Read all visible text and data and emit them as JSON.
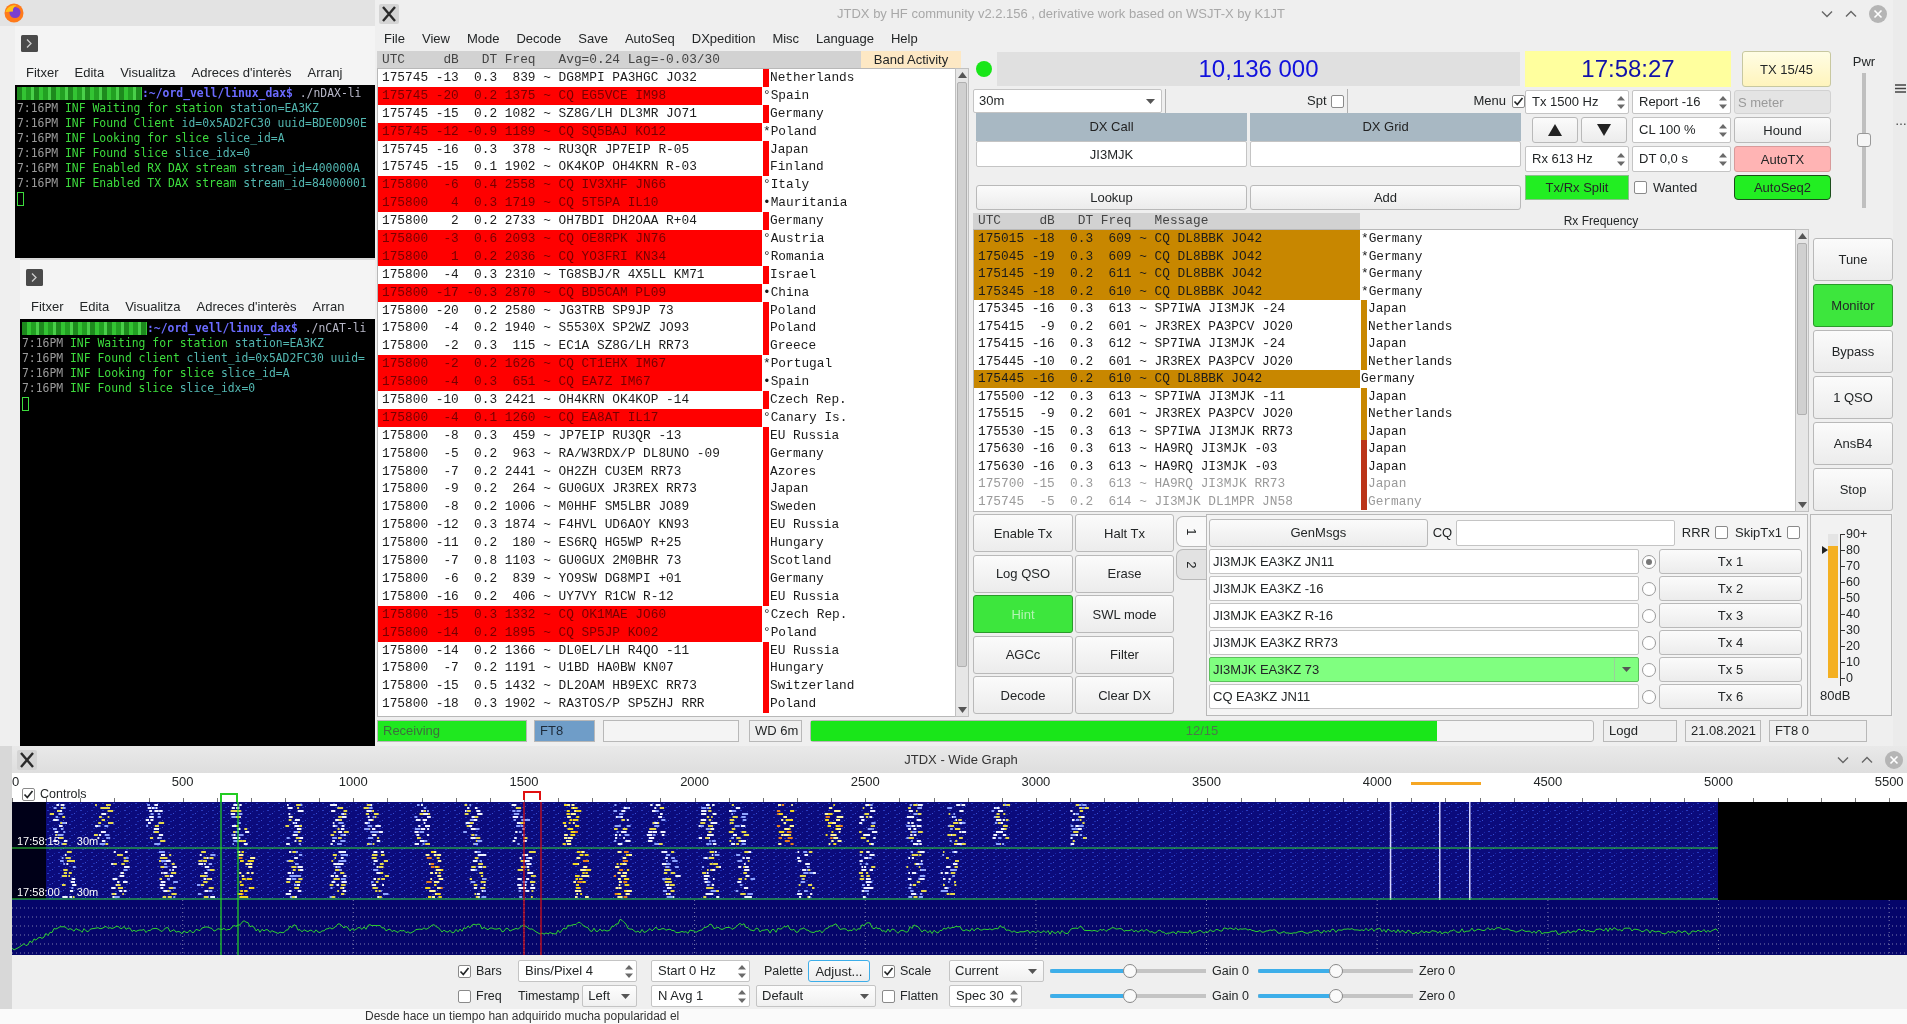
{
  "desktop": {
    "terminals": [
      {
        "menu": [
          "Fitxer",
          "Edita",
          "Visualitza",
          "Adreces d'interès",
          "Arranj"
        ],
        "prompt": {
          "path": ":~/ord_vell/linux_dax$",
          "command": "./nDAX-li"
        },
        "lines": [
          {
            "time": "7:16PM",
            "level": "INF",
            "message": "Waiting for station",
            "fields": "station=EA3KZ"
          },
          {
            "time": "7:16PM",
            "level": "INF",
            "message": "Found Client",
            "fields": "id=0x5AD2FC30 uuid=BDE0D90E"
          },
          {
            "time": "7:16PM",
            "level": "INF",
            "message": "Looking for slice",
            "fields": "slice_id=A"
          },
          {
            "time": "7:16PM",
            "level": "INF",
            "message": "Found slice",
            "fields": "slice_idx=0"
          },
          {
            "time": "7:16PM",
            "level": "INF",
            "message": "Enabled RX DAX stream",
            "fields": "stream_id=400000A"
          },
          {
            "time": "7:16PM",
            "level": "INF",
            "message": "Enabled TX DAX stream",
            "fields": "stream_id=84000001"
          }
        ]
      },
      {
        "menu": [
          "Fitxer",
          "Edita",
          "Visualitza",
          "Adreces d'interès",
          "Arran"
        ],
        "prompt": {
          "path": ":~/ord_vell/linux_dax$",
          "command": "./nCAT-li"
        },
        "lines": [
          {
            "time": "7:16PM",
            "level": "INF",
            "message": "Waiting for station",
            "fields": "station=EA3KZ"
          },
          {
            "time": "7:16PM",
            "level": "INF",
            "message": "Found client",
            "fields": "client_id=0x5AD2FC30 uuid="
          },
          {
            "time": "7:16PM",
            "level": "INF",
            "message": "Looking for slice",
            "fields": "slice_id=A"
          },
          {
            "time": "7:16PM",
            "level": "INF",
            "message": "Found slice",
            "fields": "slice_idx=0"
          }
        ]
      }
    ],
    "edge_text": "…",
    "page_text": "Desde hace un tiempo han adquirido mucha popularidad el"
  },
  "main_window": {
    "title": "JTDX by HF community v2.2.156 , derivative work based on WSJT-X by K1JT",
    "menu": [
      "File",
      "View",
      "Mode",
      "Decode",
      "Save",
      "AutoSeq",
      "DXpedition",
      "Misc",
      "Language",
      "Help"
    ]
  },
  "band_activity": {
    "title": "Band Activity",
    "columns": [
      "UTC",
      "dB",
      "DT",
      "Freq",
      "Avg=0.24 Lag=-0.03/30"
    ],
    "rows": [
      {
        "utc": "175745",
        "db": "-13",
        "dt": "0.3",
        "freq": "839",
        "message": "~ DG8MPI PA3HGC JO32",
        "country": "Netherlands",
        "highlighted": false
      },
      {
        "utc": "175745",
        "db": "-20",
        "dt": "0.2",
        "freq": "1375",
        "message": "~ CQ EG5VCE IM98",
        "country": "°Spain",
        "highlighted": true
      },
      {
        "utc": "175745",
        "db": "-15",
        "dt": "0.2",
        "freq": "1082",
        "message": "~ SZ8G/LH DL3MR JO71",
        "country": "Germany",
        "highlighted": false
      },
      {
        "utc": "175745",
        "db": "-12",
        "dt": "-0.9",
        "freq": "1189",
        "message": "~ CQ SQ5BAJ KO12",
        "country": "*Poland",
        "highlighted": true
      },
      {
        "utc": "175745",
        "db": "-16",
        "dt": "0.3",
        "freq": "378",
        "message": "~ RU3QR JP7EIP R-05",
        "country": "Japan",
        "highlighted": false
      },
      {
        "utc": "175745",
        "db": "-15",
        "dt": "0.1",
        "freq": "1902",
        "message": "~ OK4KOP OH4KRN R-03",
        "country": "Finland",
        "highlighted": false
      },
      {
        "utc": "175800",
        "db": "-6",
        "dt": "0.4",
        "freq": "2558",
        "message": "~ CQ IV3XHF JN66",
        "country": "°Italy",
        "highlighted": true
      },
      {
        "utc": "175800",
        "db": "4",
        "dt": "0.3",
        "freq": "1719",
        "message": "~ CQ 5T5PA IL10",
        "country": "•Mauritania",
        "highlighted": true
      },
      {
        "utc": "175800",
        "db": "2",
        "dt": "0.2",
        "freq": "2733",
        "message": "~ OH7BDI DH2OAA R+04",
        "country": "Germany",
        "highlighted": false
      },
      {
        "utc": "175800",
        "db": "-3",
        "dt": "0.6",
        "freq": "2093",
        "message": "~ CQ OE8RPK JN76",
        "country": "°Austria",
        "highlighted": true
      },
      {
        "utc": "175800",
        "db": "1",
        "dt": "0.2",
        "freq": "2036",
        "message": "~ CQ YO3FRI KN34",
        "country": "°Romania",
        "highlighted": true
      },
      {
        "utc": "175800",
        "db": "-4",
        "dt": "0.3",
        "freq": "2310",
        "message": "~ TG8SBJ/R 4X5LL KM71",
        "country": "Israel",
        "highlighted": false
      },
      {
        "utc": "175800",
        "db": "-17",
        "dt": "-0.3",
        "freq": "2870",
        "message": "~ CQ BD5CAM PL09",
        "country": "•China",
        "highlighted": true
      },
      {
        "utc": "175800",
        "db": "-20",
        "dt": "0.2",
        "freq": "2580",
        "message": "~ JG3TRB SP9JP 73",
        "country": "Poland",
        "highlighted": false
      },
      {
        "utc": "175800",
        "db": "-4",
        "dt": "0.2",
        "freq": "1940",
        "message": "~ S5530X SP2WZ JO93",
        "country": "Poland",
        "highlighted": false
      },
      {
        "utc": "175800",
        "db": "-2",
        "dt": "0.3",
        "freq": "115",
        "message": "~ EC1A SZ8G/LH RR73",
        "country": "Greece",
        "highlighted": false
      },
      {
        "utc": "175800",
        "db": "-2",
        "dt": "0.2",
        "freq": "1626",
        "message": "~ CQ CT1EHX IM67",
        "country": "*Portugal",
        "highlighted": true
      },
      {
        "utc": "175800",
        "db": "-4",
        "dt": "0.3",
        "freq": "651",
        "message": "~ CQ EA7Z IM67",
        "country": "•Spain",
        "highlighted": true
      },
      {
        "utc": "175800",
        "db": "-10",
        "dt": "0.3",
        "freq": "2421",
        "message": "~ OH4KRN OK4KOP -14",
        "country": "Czech Rep.",
        "highlighted": false
      },
      {
        "utc": "175800",
        "db": "-4",
        "dt": "0.1",
        "freq": "1260",
        "message": "~ CQ EA8AT IL17",
        "country": "°Canary Is.",
        "highlighted": true
      },
      {
        "utc": "175800",
        "db": "-8",
        "dt": "0.3",
        "freq": "459",
        "message": "~ JP7EIP RU3QR -13",
        "country": "EU Russia",
        "highlighted": false
      },
      {
        "utc": "175800",
        "db": "-5",
        "dt": "0.2",
        "freq": "963",
        "message": "~ RA/W3RDX/P DL8UNO -09",
        "country": "Germany",
        "highlighted": false
      },
      {
        "utc": "175800",
        "db": "-7",
        "dt": "0.2",
        "freq": "2441",
        "message": "~ OH2ZH CU3EM RR73",
        "country": "Azores",
        "highlighted": false
      },
      {
        "utc": "175800",
        "db": "-9",
        "dt": "0.2",
        "freq": "264",
        "message": "~ GU0GUX JR3REX RR73",
        "country": "Japan",
        "highlighted": false
      },
      {
        "utc": "175800",
        "db": "-8",
        "dt": "0.2",
        "freq": "1006",
        "message": "~ M0HHF SM5LBR JO89",
        "country": "Sweden",
        "highlighted": false
      },
      {
        "utc": "175800",
        "db": "-12",
        "dt": "0.3",
        "freq": "1874",
        "message": "~ F4HVL UD6AOY KN93",
        "country": "EU Russia",
        "highlighted": false
      },
      {
        "utc": "175800",
        "db": "-11",
        "dt": "0.2",
        "freq": "180",
        "message": "~ ES6RQ HG5WP R+25",
        "country": "Hungary",
        "highlighted": false
      },
      {
        "utc": "175800",
        "db": "-7",
        "dt": "0.8",
        "freq": "1103",
        "message": "~ GU0GUX 2M0BHR 73",
        "country": "Scotland",
        "highlighted": false
      },
      {
        "utc": "175800",
        "db": "-6",
        "dt": "0.2",
        "freq": "839",
        "message": "~ YO9SW DG8MPI +01",
        "country": "Germany",
        "highlighted": false
      },
      {
        "utc": "175800",
        "db": "-16",
        "dt": "0.2",
        "freq": "406",
        "message": "~ UY7VY R1CW R-12",
        "country": "EU Russia",
        "highlighted": false
      },
      {
        "utc": "175800",
        "db": "-15",
        "dt": "0.3",
        "freq": "1332",
        "message": "~ CQ OK1MAE JO60",
        "country": "°Czech Rep.",
        "highlighted": true
      },
      {
        "utc": "175800",
        "db": "-14",
        "dt": "0.2",
        "freq": "1895",
        "message": "~ CQ SP5JP KO02",
        "country": "°Poland",
        "highlighted": true
      },
      {
        "utc": "175800",
        "db": "-14",
        "dt": "0.2",
        "freq": "1366",
        "message": "~ DL0EL/LH R4QO -11",
        "country": "EU Russia",
        "highlighted": false
      },
      {
        "utc": "175800",
        "db": "-7",
        "dt": "0.2",
        "freq": "1191",
        "message": "~ U1BD HA0BW KN07",
        "country": "Hungary",
        "highlighted": false
      },
      {
        "utc": "175800",
        "db": "-15",
        "dt": "0.5",
        "freq": "1432",
        "message": "~ DL2OAM HB9EXC RR73",
        "country": "Switzerland",
        "highlighted": false
      },
      {
        "utc": "175800",
        "db": "-18",
        "dt": "0.3",
        "freq": "1902",
        "message": "~ RA3TOS/P SP5ZHJ RRR",
        "country": "Poland",
        "highlighted": false
      }
    ]
  },
  "top": {
    "decoder_on": true,
    "frequency": "10,136 000",
    "clock": "17:58:27",
    "tx_period": "TX 15/45",
    "band": "30m",
    "spt": {
      "label": "Spt",
      "checked": false
    },
    "menu_toggle": {
      "label": "Menu",
      "checked": true
    },
    "dx_call": {
      "label": "DX Call",
      "value": "JI3MJK"
    },
    "dx_grid": {
      "label": "DX Grid"
    },
    "lookup": "Lookup",
    "add": "Add",
    "tx_freq": "Tx 1500 Hz",
    "report": "Report -16",
    "s_meter": {
      "label": "S meter",
      "disabled": true
    },
    "cl": "CL 100 %",
    "hound": "Hound",
    "rx_freq": "Rx 613 Hz",
    "dt": "DT 0,0 s",
    "auto_tx": {
      "label": "AutoTX",
      "on": false
    },
    "split": {
      "label": "Tx/Rx Split",
      "on": true
    },
    "wanted": {
      "label": "Wanted",
      "checked": false
    },
    "autoseq": {
      "label": "AutoSeq2",
      "on": true
    },
    "power": {
      "label": "Pwr",
      "level": 0.5
    }
  },
  "rx_frequency": {
    "title": "Rx Frequency",
    "columns": [
      "UTC",
      "dB",
      "DT",
      "Freq",
      "Message"
    ],
    "rows": [
      {
        "utc": "175015",
        "db": "-18",
        "dt": "0.3",
        "freq": "609",
        "message": "~ CQ DL8BBK JO42",
        "country": "*Germany",
        "highlighted": true,
        "color": "#c88700",
        "dimmed": false
      },
      {
        "utc": "175045",
        "db": "-19",
        "dt": "0.3",
        "freq": "609",
        "message": "~ CQ DL8BBK JO42",
        "country": "*Germany",
        "highlighted": true,
        "color": "#c88700",
        "dimmed": false
      },
      {
        "utc": "175145",
        "db": "-19",
        "dt": "0.2",
        "freq": "611",
        "message": "~ CQ DL8BBK JO42",
        "country": "*Germany",
        "highlighted": true,
        "color": "#c88700",
        "dimmed": false
      },
      {
        "utc": "175345",
        "db": "-18",
        "dt": "0.2",
        "freq": "610",
        "message": "~ CQ DL8BBK JO42",
        "country": "*Germany",
        "highlighted": true,
        "color": "#c88700",
        "dimmed": false
      },
      {
        "utc": "175345",
        "db": "-16",
        "dt": "0.3",
        "freq": "613",
        "message": "~ SP7IWA JI3MJK -24",
        "country": "Japan",
        "highlighted": false,
        "color": "#c88700",
        "dimmed": false
      },
      {
        "utc": "175415",
        "db": "-9",
        "dt": "0.2",
        "freq": "601",
        "message": "~ JR3REX PA3PCV JO20",
        "country": "Netherlands",
        "highlighted": false,
        "color": "#c88700",
        "dimmed": false
      },
      {
        "utc": "175415",
        "db": "-16",
        "dt": "0.3",
        "freq": "612",
        "message": "~ SP7IWA JI3MJK -24",
        "country": "Japan",
        "highlighted": false,
        "color": "#c88700",
        "dimmed": false
      },
      {
        "utc": "175445",
        "db": "-10",
        "dt": "0.2",
        "freq": "601",
        "message": "~ JR3REX PA3PCV JO20",
        "country": "Netherlands",
        "highlighted": false,
        "color": "#c88700",
        "dimmed": false
      },
      {
        "utc": "175445",
        "db": "-16",
        "dt": "0.2",
        "freq": "610",
        "message": "~ CQ DL8BBK JO42",
        "country": "Germany",
        "highlighted": true,
        "color": "#c88700",
        "dimmed": false
      },
      {
        "utc": "175500",
        "db": "-12",
        "dt": "0.3",
        "freq": "613",
        "message": "~ SP7IWA JI3MJK -11",
        "country": "Japan",
        "highlighted": false,
        "color": "#c88700",
        "dimmed": false
      },
      {
        "utc": "175515",
        "db": "-9",
        "dt": "0.2",
        "freq": "601",
        "message": "~ JR3REX PA3PCV JO20",
        "country": "Netherlands",
        "highlighted": false,
        "color": "#c88700",
        "dimmed": false
      },
      {
        "utc": "175530",
        "db": "-15",
        "dt": "0.3",
        "freq": "613",
        "message": "~ SP7IWA JI3MJK RR73",
        "country": "Japan",
        "highlighted": false,
        "color": "#c88700",
        "dimmed": false
      },
      {
        "utc": "175630",
        "db": "-16",
        "dt": "0.3",
        "freq": "613",
        "message": "~ HA9RQ JI3MJK -03",
        "country": "Japan",
        "highlighted": false,
        "color": "#bb3418",
        "dimmed": false
      },
      {
        "utc": "175630",
        "db": "-16",
        "dt": "0.3",
        "freq": "613",
        "message": "~ HA9RQ JI3MJK -03",
        "country": "Japan",
        "highlighted": false,
        "color": "#bb3418",
        "dimmed": false
      },
      {
        "utc": "175700",
        "db": "-15",
        "dt": "0.3",
        "freq": "613",
        "message": "~ HA9RQ JI3MJK RR73",
        "country": "Japan",
        "highlighted": false,
        "color": "#bb3418",
        "dimmed": true
      },
      {
        "utc": "175745",
        "db": "-5",
        "dt": "0.2",
        "freq": "614",
        "message": "~ JI3MJK DL1MPR JN58",
        "country": "Germany",
        "highlighted": false,
        "color": "#bb3418",
        "dimmed": true
      }
    ]
  },
  "side_buttons": [
    {
      "label": "Tune",
      "on": false
    },
    {
      "label": "Monitor",
      "on": true
    },
    {
      "label": "Bypass",
      "on": false
    },
    {
      "label": "1 QSO",
      "on": false
    },
    {
      "label": "AnsB4",
      "on": false
    },
    {
      "label": "Stop",
      "on": false
    }
  ],
  "action_buttons": [
    {
      "label": "Enable Tx",
      "on": false,
      "disabled": false
    },
    {
      "label": "Halt Tx",
      "on": false,
      "disabled": false
    },
    {
      "label": "Log QSO",
      "on": false,
      "disabled": false
    },
    {
      "label": "Erase",
      "on": false,
      "disabled": false
    },
    {
      "label": "Hint",
      "on": true,
      "disabled": true
    },
    {
      "label": "SWL mode",
      "on": false,
      "disabled": false
    },
    {
      "label": "AGCc",
      "on": false,
      "disabled": false
    },
    {
      "label": "Filter",
      "on": false,
      "disabled": false
    },
    {
      "label": "Decode",
      "on": false,
      "disabled": false
    },
    {
      "label": "Clear DX",
      "on": false,
      "disabled": false
    }
  ],
  "tx_panel": {
    "tabs": [
      {
        "label": "1",
        "selected": true
      },
      {
        "label": "2",
        "selected": false
      }
    ],
    "genmsgs": "GenMsgs",
    "cq_label": "CQ",
    "rrr": {
      "label": "RRR",
      "checked": false
    },
    "skip_tx1": {
      "label": "SkipTx1",
      "checked": false
    },
    "messages": [
      {
        "kind": "field",
        "text": "JI3MJK EA3KZ JN11",
        "selected": true,
        "highlighted": false,
        "button": "Tx 1"
      },
      {
        "kind": "field",
        "text": "JI3MJK EA3KZ -16",
        "selected": false,
        "highlighted": false,
        "button": "Tx 2"
      },
      {
        "kind": "field",
        "text": "JI3MJK EA3KZ R-16",
        "selected": false,
        "highlighted": false,
        "button": "Tx 3"
      },
      {
        "kind": "field",
        "text": "JI3MJK EA3KZ RR73",
        "selected": false,
        "highlighted": false,
        "button": "Tx 4"
      },
      {
        "kind": "combo",
        "text": "JI3MJK EA3KZ 73",
        "selected": false,
        "highlighted": true,
        "button": "Tx 5"
      },
      {
        "kind": "field",
        "text": "CQ EA3KZ JN11",
        "selected": false,
        "highlighted": false,
        "button": "Tx 6"
      }
    ]
  },
  "signal_meter": {
    "scale": [
      "90+",
      "80",
      "70",
      "60",
      "50",
      "40",
      "30",
      "20",
      "10",
      "0"
    ],
    "level": 0.92,
    "reading": "80dB"
  },
  "status_bar": {
    "transmitting": false,
    "state": "Receiving",
    "mode": "FT8",
    "watchdog": "WD 6m",
    "progress": {
      "label": "12/15",
      "level": 0.8
    },
    "log": "Logd",
    "date": "21.08.2021",
    "mode_count": "FT8 0"
  },
  "wide_graph": {
    "title": "JTDX - Wide Graph",
    "controls_toggle": {
      "label": "Controls",
      "checked": true
    },
    "scale": [
      "0",
      "500",
      "1000",
      "1500",
      "2000",
      "2500",
      "3000",
      "3500",
      "4000",
      "4500",
      "5000",
      "5500"
    ],
    "timestamps": [
      "17:58:15 30m",
      "17:58:00 30m"
    ],
    "bars": {
      "label": "Bars",
      "checked": true
    },
    "bins": "Bins/Pixel 4",
    "start": "Start 0 Hz",
    "palette_label": "Palette",
    "adjust": "Adjust...",
    "scale_toggle": {
      "label": "Scale",
      "checked": true
    },
    "spectrum_mode": "Current",
    "freq": {
      "label": "Freq",
      "checked": false
    },
    "timestamp_label": "Timestamp",
    "timestamp_pos": "Left",
    "navg": "N Avg 1",
    "palette": "Default",
    "flatten": {
      "label": "Flatten",
      "checked": false
    },
    "spec": "Spec 30",
    "sliders": [
      {
        "level": 0.51,
        "label": "Gain 0"
      },
      {
        "level": 0.5,
        "label": "Zero 0"
      },
      {
        "level": 0.51,
        "label": "Gain 0"
      },
      {
        "level": 0.5,
        "label": "Zero 0"
      }
    ]
  }
}
